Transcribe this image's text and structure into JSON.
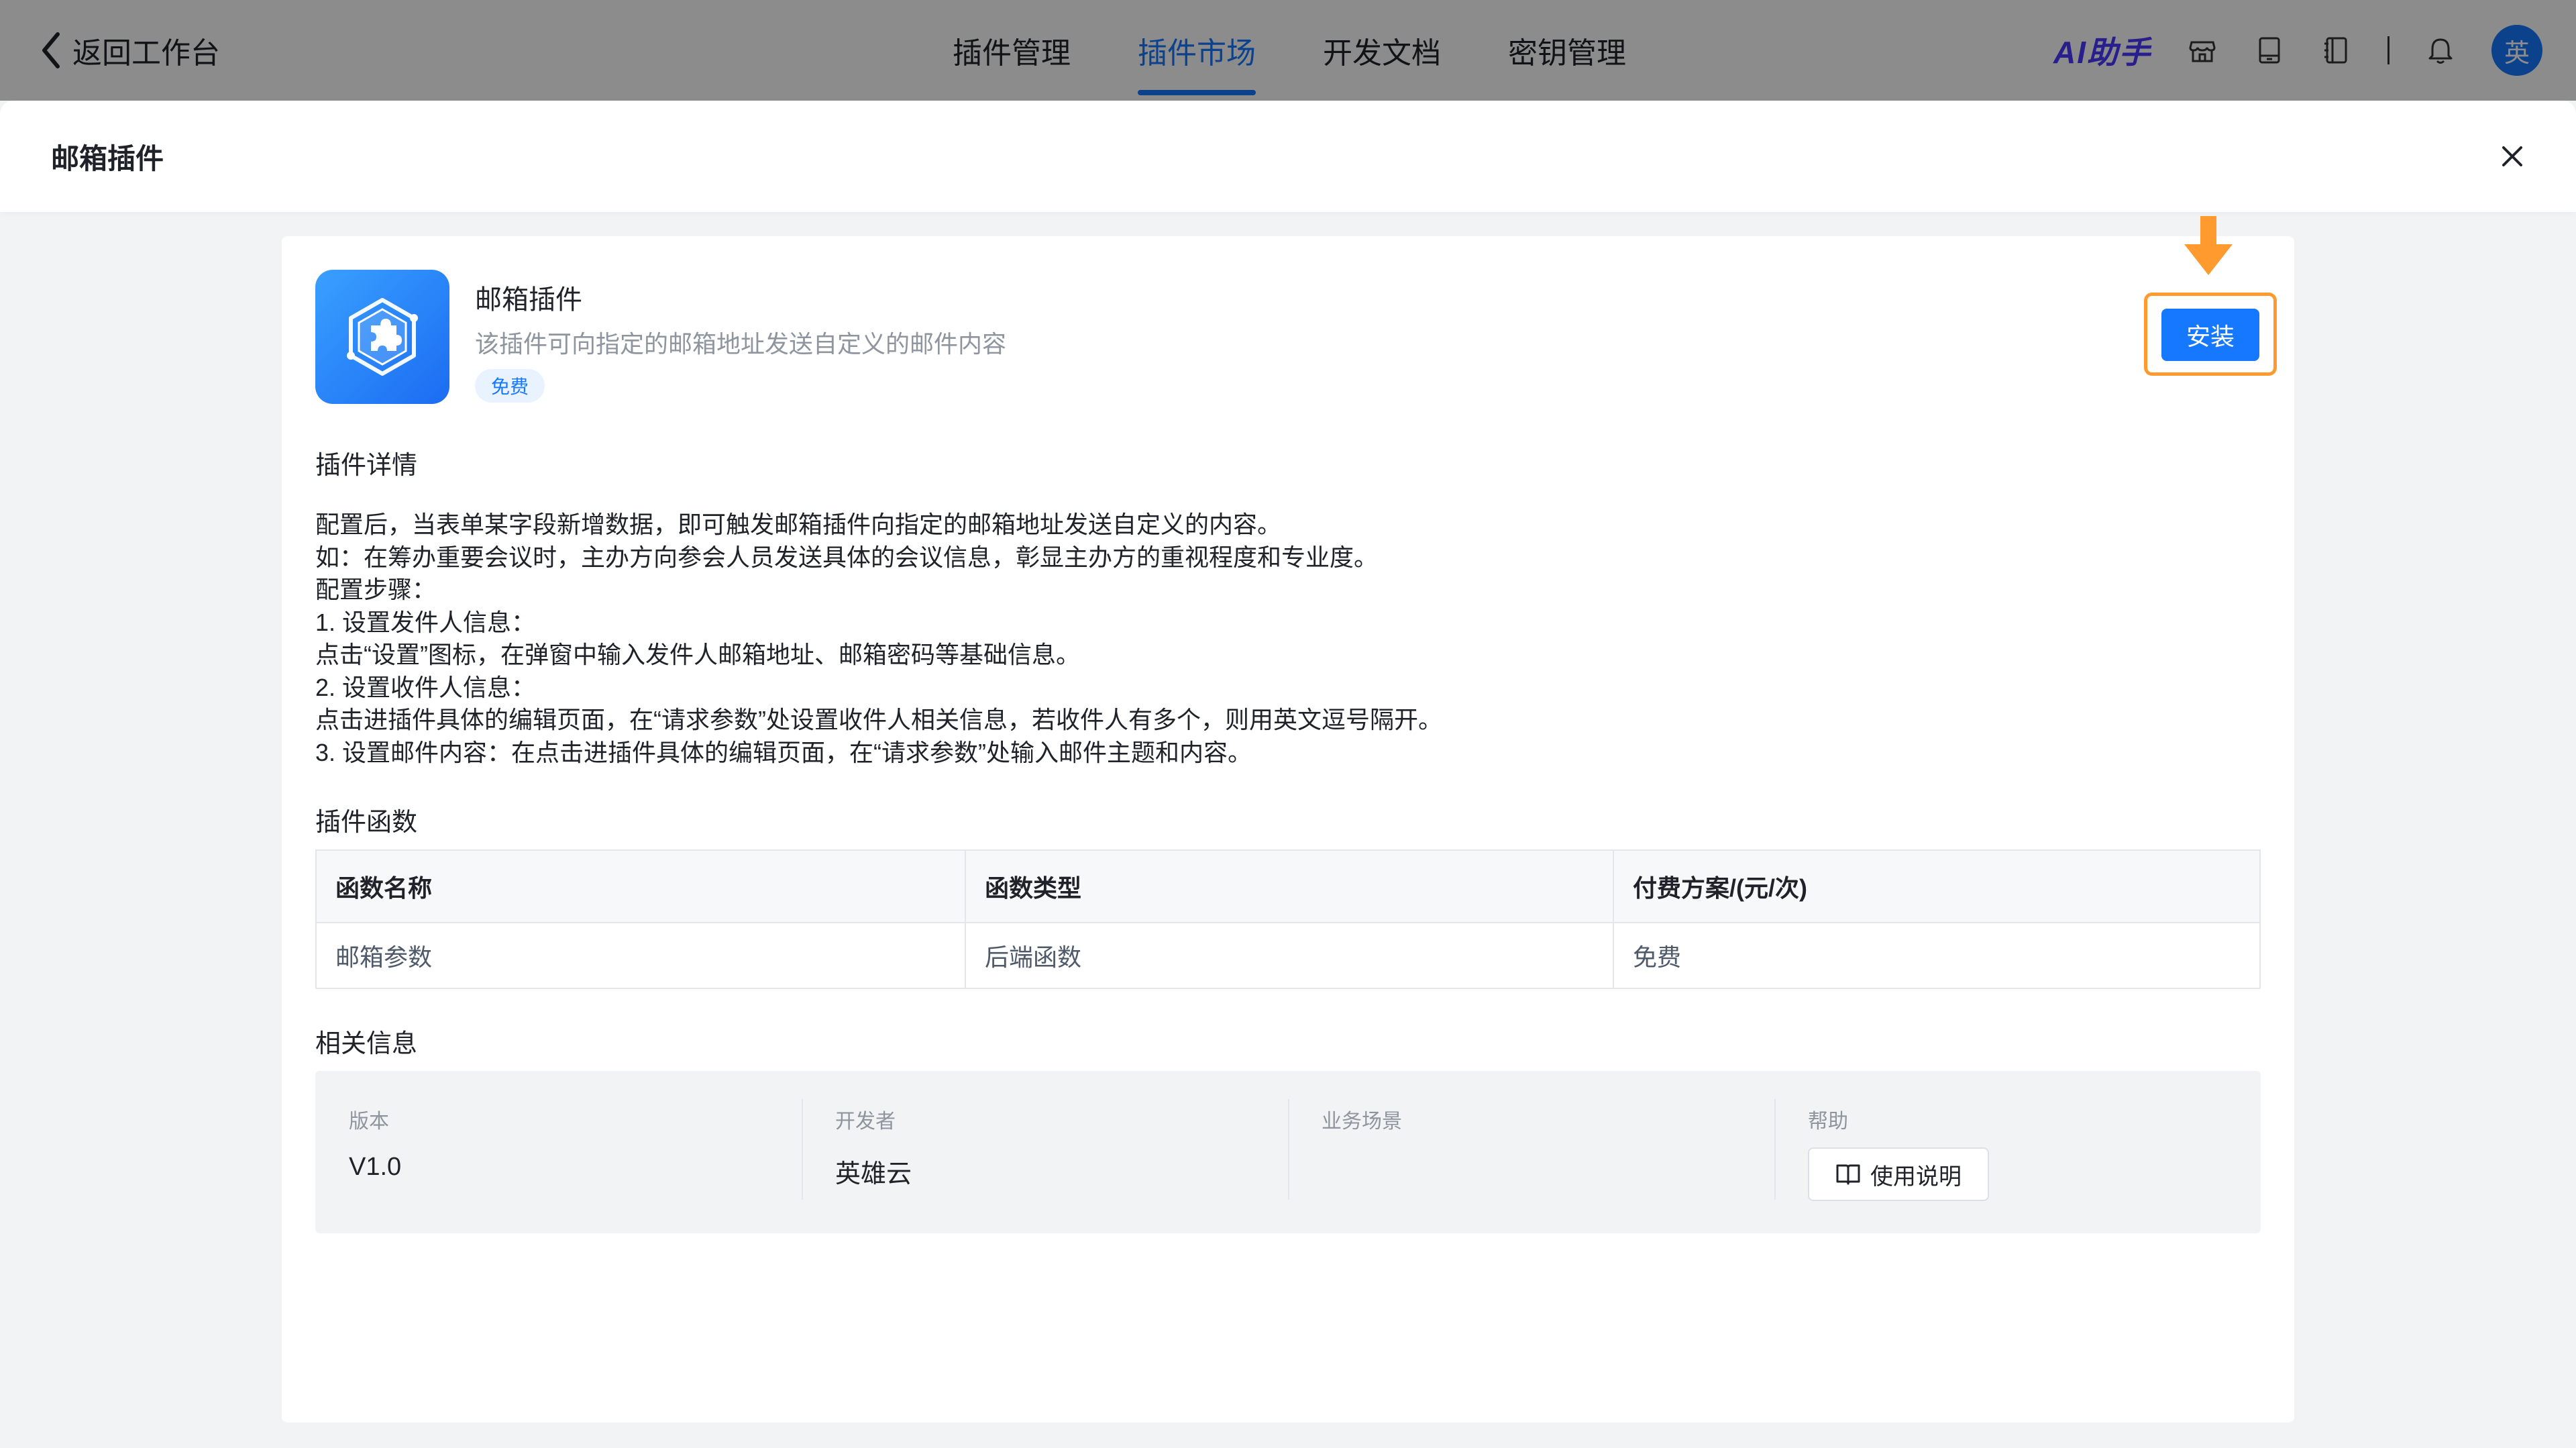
{
  "topbar": {
    "back_label": "返回工作台",
    "tabs": [
      {
        "label": "插件管理"
      },
      {
        "label": "插件市场"
      },
      {
        "label": "开发文档"
      },
      {
        "label": "密钥管理"
      }
    ],
    "active_tab": "插件市场",
    "ai_brand": "AI助手",
    "avatar_text": "英",
    "icons": [
      "store-icon",
      "tablet-icon",
      "notebook-icon",
      "bell-icon"
    ]
  },
  "drawer": {
    "title": "邮箱插件"
  },
  "plugin": {
    "name": "邮箱插件",
    "description": "该插件可向指定的邮箱地址发送自定义的邮件内容",
    "price_tag": "免费",
    "install_label": "安装"
  },
  "details": {
    "heading": "插件详情",
    "lines": [
      "配置后，当表单某字段新增数据，即可触发邮箱插件向指定的邮箱地址发送自定义的内容。",
      "如：在筹办重要会议时，主办方向参会人员发送具体的会议信息，彰显主办方的重视程度和专业度。",
      "配置步骤：",
      "1. 设置发件人信息：",
      "点击“设置”图标，在弹窗中输入发件人邮箱地址、邮箱密码等基础信息。",
      "2. 设置收件人信息：",
      "点击进插件具体的编辑页面，在“请求参数”处设置收件人相关信息，若收件人有多个，则用英文逗号隔开。",
      "3. 设置邮件内容：在点击进插件具体的编辑页面，在“请求参数”处输入邮件主题和内容。"
    ]
  },
  "functions": {
    "heading": "插件函数",
    "columns": [
      "函数名称",
      "函数类型",
      "付费方案/(元/次)"
    ],
    "rows": [
      [
        "邮箱参数",
        "后端函数",
        "免费"
      ]
    ]
  },
  "related": {
    "heading": "相关信息",
    "version_label": "版本",
    "version_value": "V1.0",
    "developer_label": "开发者",
    "developer_value": "英雄云",
    "scenario_label": "业务场景",
    "scenario_value": "",
    "help_label": "帮助",
    "help_button": "使用说明"
  },
  "colors": {
    "accent": "#1677ff",
    "highlight": "#ff9a2e"
  }
}
